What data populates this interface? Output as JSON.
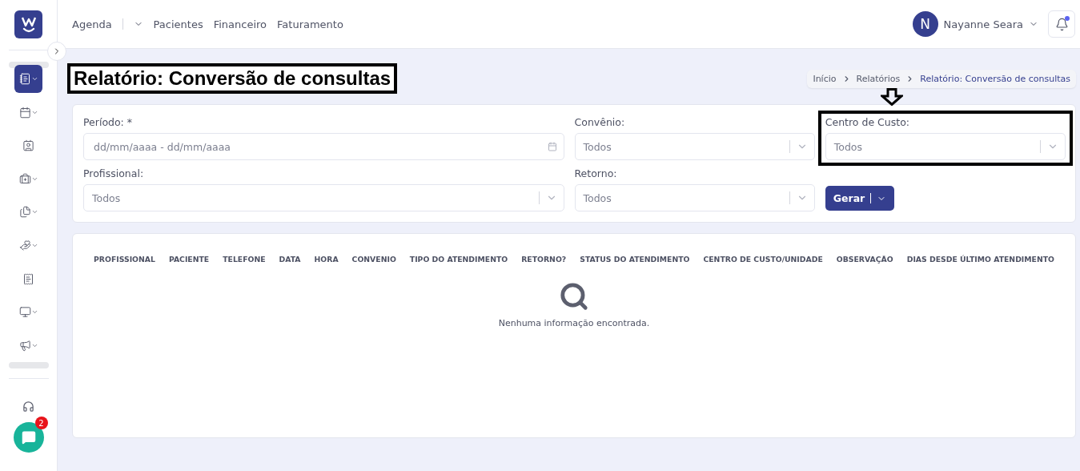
{
  "nav": [
    {
      "label": "Agenda",
      "dropdown": true
    },
    {
      "label": "Pacientes",
      "dropdown": false
    },
    {
      "label": "Financeiro",
      "dropdown": false
    },
    {
      "label": "Faturamento",
      "dropdown": false
    }
  ],
  "user": {
    "initial": "N",
    "name": "Nayanne Seara"
  },
  "notifications": {
    "unread": true
  },
  "sidebar": {
    "items": [
      {
        "selected": true,
        "dropdown": true
      },
      {
        "selected": false,
        "dropdown": true
      },
      {
        "selected": false,
        "dropdown": false
      },
      {
        "selected": false,
        "dropdown": true
      },
      {
        "selected": false,
        "dropdown": true
      },
      {
        "selected": false,
        "dropdown": true
      },
      {
        "selected": false,
        "dropdown": false
      },
      {
        "selected": false,
        "dropdown": true
      },
      {
        "selected": false,
        "dropdown": true
      }
    ]
  },
  "chat": {
    "badge": "2"
  },
  "page_title": {
    "text": "Relatório: Conversão de consultas",
    "highlighted": true
  },
  "breadcrumb": [
    "Início",
    "Relatórios",
    "Relatório: Conversão de consultas"
  ],
  "filters": [
    {
      "label": "Período: *",
      "kind": "date",
      "placeholder": "dd/mm/aaaa - dd/mm/aaaa",
      "highlighted": false
    },
    {
      "label": "Convênio:",
      "kind": "select",
      "value": "Todos",
      "highlighted": false
    },
    {
      "label": "Centro de Custo:",
      "kind": "select",
      "value": "Todos",
      "highlighted": true
    },
    {
      "label": "Profissional:",
      "kind": "select",
      "value": "Todos",
      "highlighted": false
    },
    {
      "label": "Retorno:",
      "kind": "select",
      "value": "Todos",
      "highlighted": false
    }
  ],
  "generate_button": {
    "label": "Gerar"
  },
  "table": {
    "columns": [
      "PROFISSIONAL",
      "PACIENTE",
      "TELEFONE",
      "DATA",
      "HORA",
      "CONVENIO",
      "TIPO DO ATENDIMENTO",
      "RETORNO?",
      "STATUS DO ATENDIMENTO",
      "CENTRO DE CUSTO/UNIDADE",
      "OBSERVAÇÃO",
      "DIAS DESDE ÚLTIMO ATENDIMENTO"
    ],
    "empty_message": "Nenhuma informação encontrada."
  }
}
